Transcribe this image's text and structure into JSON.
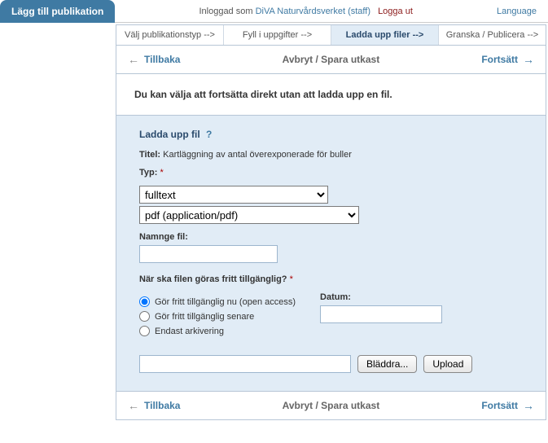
{
  "top": {
    "tab_title": "Lägg till publikation",
    "logged_in_as": "Inloggad som",
    "user": "DiVA Naturvårdsverket (staff)",
    "logout": "Logga ut",
    "language": "Language"
  },
  "steps": {
    "s1": "Välj publikationstyp -->",
    "s2": "Fyll i uppgifter -->",
    "s3": "Ladda upp filer -->",
    "s4": "Granska / Publicera -->"
  },
  "nav": {
    "back": "Tillbaka",
    "cancel_save": "Avbryt / Spara utkast",
    "continue": "Fortsätt"
  },
  "info": "Du kan välja att fortsätta direkt utan att ladda upp en fil.",
  "upload": {
    "heading": "Ladda upp fil",
    "help": "?",
    "title_label": "Titel:",
    "title_value": "Kartläggning av antal överexponerade för buller",
    "type_label": "Typ:",
    "type_options": [
      "fulltext"
    ],
    "type_selected": "fulltext",
    "format_options": [
      "pdf (application/pdf)"
    ],
    "format_selected": "pdf (application/pdf)",
    "name_label": "Namnge fil:",
    "name_value": "",
    "avail_label": "När ska filen göras fritt tillgänglig?",
    "r1": "Gör fritt tillgänglig nu (open access)",
    "r2": "Gör fritt tillgänglig senare",
    "r3": "Endast arkivering",
    "date_label": "Datum:",
    "date_value": "",
    "file_value": "",
    "browse_btn": "Bläddra...",
    "upload_btn": "Upload"
  }
}
